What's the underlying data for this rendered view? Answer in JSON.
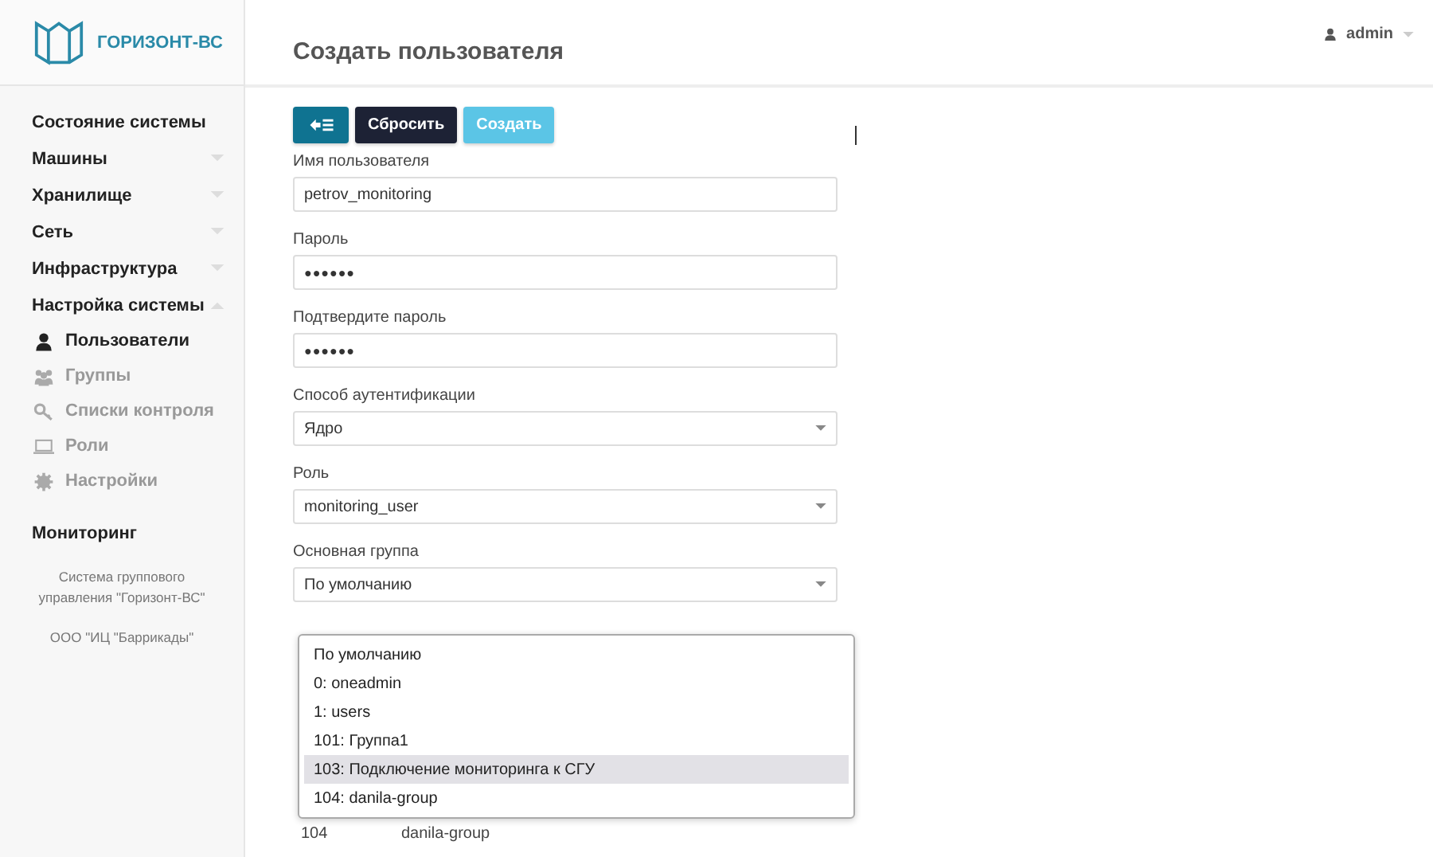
{
  "brand": {
    "name": "ГОРИЗОНТ-ВС"
  },
  "sidebar": {
    "items": [
      {
        "label": "Состояние системы"
      },
      {
        "label": "Машины",
        "expanded": false
      },
      {
        "label": "Хранилище",
        "expanded": false
      },
      {
        "label": "Сеть",
        "expanded": false
      },
      {
        "label": "Инфраструктура",
        "expanded": false
      },
      {
        "label": "Настройка системы",
        "expanded": true,
        "children": [
          {
            "label": "Пользователи",
            "selected": true
          },
          {
            "label": "Группы",
            "selected": false
          },
          {
            "label": "Списки контроля",
            "selected": false
          },
          {
            "label": "Роли",
            "selected": false
          },
          {
            "label": "Настройки",
            "selected": false
          }
        ]
      },
      {
        "label": "Мониторинг"
      }
    ],
    "footer": [
      "Система группового управления \"Горизонт-ВС\"",
      "ООО \"ИЦ \"Баррикады\""
    ]
  },
  "header": {
    "title": "Создать пользователя",
    "user": "admin"
  },
  "toolbar": {
    "reset": "Сбросить",
    "create": "Создать"
  },
  "fields": [
    {
      "label": "Имя пользователя",
      "kind": "text",
      "value": "petrov_monitoring"
    },
    {
      "label": "Пароль",
      "kind": "password",
      "value": "●●●●●●"
    },
    {
      "label": "Подтвердите пароль",
      "kind": "password",
      "value": "●●●●●●"
    },
    {
      "label": "Способ аутентификации",
      "kind": "select",
      "value": "Ядро"
    },
    {
      "label": "Роль",
      "kind": "select",
      "value": "monitoring_user"
    },
    {
      "label": "Основная группа",
      "kind": "select",
      "value": "По умолчанию"
    }
  ],
  "table_row": [
    "104",
    "danila-group"
  ],
  "dropdown": {
    "options": [
      {
        "label": "По умолчанию",
        "selected": false
      },
      {
        "label": "0: oneadmin",
        "selected": false
      },
      {
        "label": "1: users",
        "selected": false
      },
      {
        "label": "101: Группа1",
        "selected": false
      },
      {
        "label": "103: Подключение мониторинга к СГУ",
        "selected": true
      },
      {
        "label": "104: danila-group",
        "selected": false
      }
    ]
  }
}
